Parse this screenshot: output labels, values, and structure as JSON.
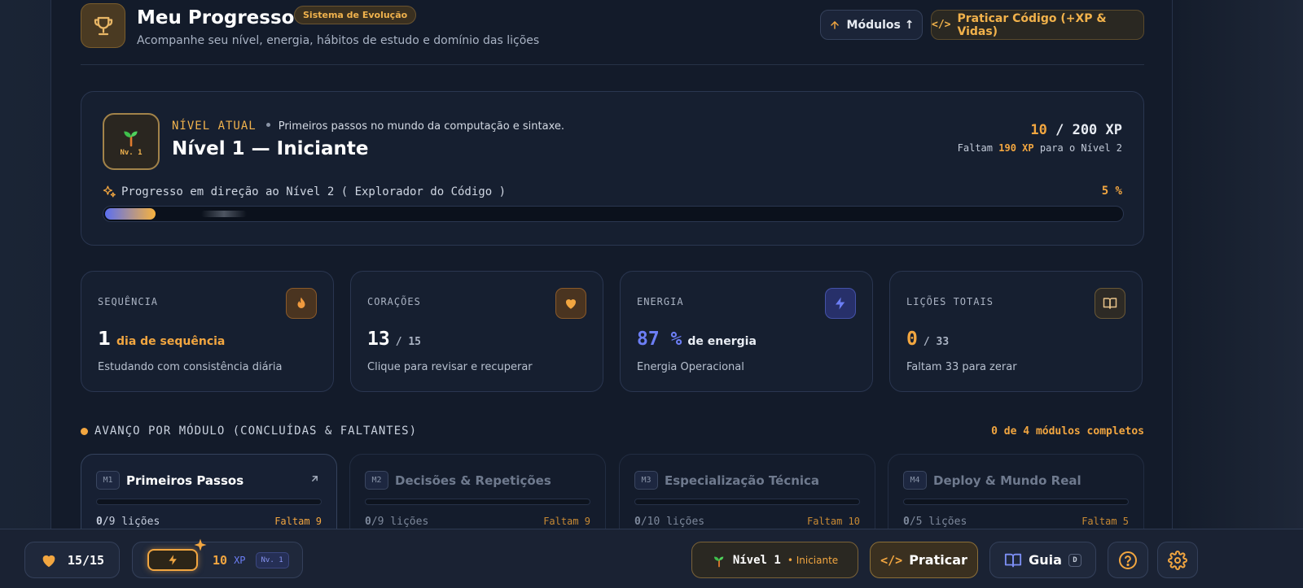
{
  "header": {
    "title": "Meu Progresso",
    "badge": "Sistema de Evolução",
    "subtitle": "Acompanhe seu nível, energia, hábitos de estudo e domínio das lições",
    "modules_button": "Módulos ↑",
    "practice_button": "Praticar Código (+XP & Vidas)"
  },
  "level_card": {
    "badge_label": "Nv. 1",
    "eyebrow": "NÍVEL ATUAL",
    "description": "Primeiros passos no mundo da computação e sintaxe.",
    "name": "Nível 1 — Iniciante",
    "xp_current": "10",
    "xp_sep": "/",
    "xp_total": "200 XP",
    "remaining_prefix": "Faltam",
    "remaining_xp": "190 XP",
    "remaining_suffix": "para o Nível 2",
    "progress_label": "Progresso em direção ao Nível 2 ( Explorador do Código )",
    "progress_percent_label": "5 %",
    "progress_fraction": 0.05
  },
  "stats": [
    {
      "label": "SEQUÊNCIA",
      "value": "1",
      "unit": "dia de sequência",
      "desc": "Estudando com consistência diária",
      "icon": "flame-icon",
      "color": "#f2a640"
    },
    {
      "label": "CORAÇÕES",
      "value": "13",
      "unit": "/ 15",
      "desc": "Clique para revisar e recuperar",
      "icon": "heart-icon",
      "color": "#f2a640"
    },
    {
      "label": "ENERGIA",
      "value": "87 %",
      "unit": "de energia",
      "desc": "Energia Operacional",
      "icon": "lightning-icon",
      "color": "#6c7ef5"
    },
    {
      "label": "LIÇÕES TOTAIS",
      "value": "0",
      "unit": "/ 33",
      "desc": "Faltam 33 para zerar",
      "icon": "book-icon",
      "color": "#f2a640"
    }
  ],
  "modules_section": {
    "title": "AVANÇO POR MÓDULO (CONCLUÍDAS & FALTANTES)",
    "summary": "0 de 4 módulos completos",
    "modules": [
      {
        "tag": "M1",
        "name": "Primeiros Passos",
        "done": "0",
        "total": "/9 lições",
        "remaining": "Faltam 9",
        "progress": 0
      },
      {
        "tag": "M2",
        "name": "Decisões & Repetições",
        "done": "0",
        "total": "/9 lições",
        "remaining": "Faltam 9",
        "progress": 0
      },
      {
        "tag": "M3",
        "name": "Especialização Técnica",
        "done": "0",
        "total": "/10 lições",
        "remaining": "Faltam 10",
        "progress": 0
      },
      {
        "tag": "M4",
        "name": "Deploy & Mundo Real",
        "done": "0",
        "total": "/5 lições",
        "remaining": "Faltam 5",
        "progress": 0
      }
    ]
  },
  "bottom_bar": {
    "hearts": "15/15",
    "xp_value": "10",
    "xp_label": "XP",
    "level_badge": "Nv. 1",
    "level_pill": "Nível 1",
    "level_pill_sub": "• Iniciante",
    "practice": "Praticar",
    "guide": "Guia",
    "guide_key": "D"
  },
  "colors": {
    "accent": "#f2a640",
    "energy": "#6c7ef5",
    "background": "#131b2a"
  }
}
